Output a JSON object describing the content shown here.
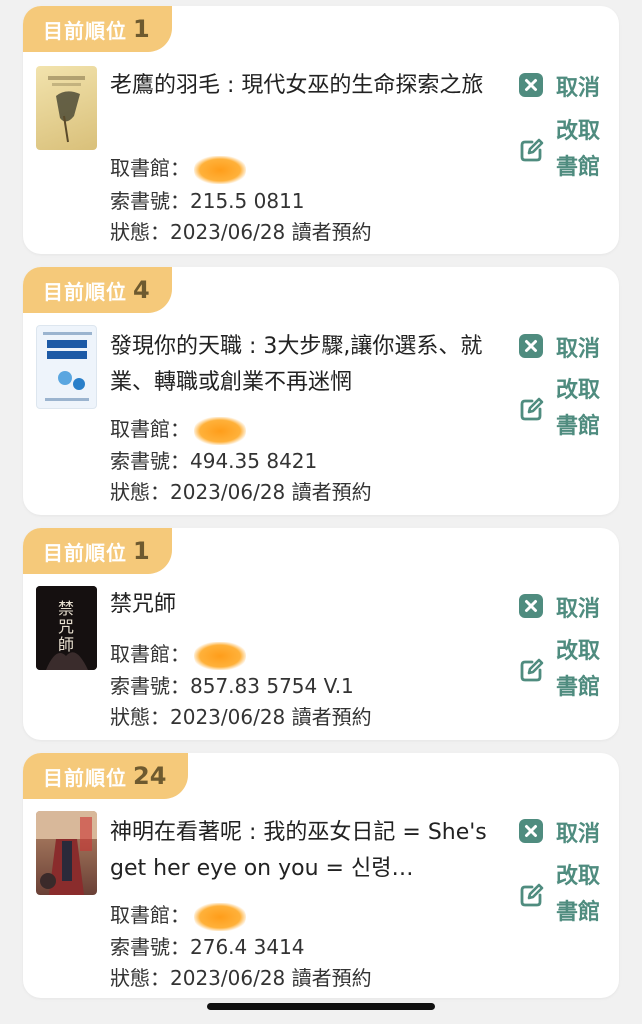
{
  "labels": {
    "queue": "目前順位",
    "branch": "取書館：",
    "callno": "索書號：",
    "status": "狀態：",
    "cancel": "取消",
    "change": "改取書館"
  },
  "items": [
    {
      "position": "1",
      "title": "老鷹的羽毛 : 現代女巫的生命探索之旅",
      "branch": "",
      "call_number": "215.5 0811",
      "status": "2023/06/28 讀者預約",
      "cover_color": "#e9d79a"
    },
    {
      "position": "4",
      "title": "發現你的天職 : 3大步驟,讓你選系、就業、轉職或創業不再迷惘",
      "branch": "",
      "call_number": "494.35 8421",
      "status": "2023/06/28 讀者預約",
      "cover_color": "#e9f2fb"
    },
    {
      "position": "1",
      "title": "禁咒師",
      "branch": "",
      "call_number": "857.83 5754 V.1",
      "status": "2023/06/28 讀者預約",
      "cover_color": "#1a1414"
    },
    {
      "position": "24",
      "title": "神明在看著呢 : 我的巫女日記 = She's get her eye on you = 신령…",
      "branch": "",
      "call_number": "276.4 3414",
      "status": "2023/06/28 讀者預約",
      "cover_color": "#8a5a48"
    }
  ],
  "colors": {
    "accent": "#4f8c7f",
    "badge": "#f5c97a",
    "badge_number": "#6e5a2f",
    "redaction": "#ff9d1a"
  },
  "icons": {
    "cancel": "close-box-icon",
    "change": "edit-icon"
  }
}
